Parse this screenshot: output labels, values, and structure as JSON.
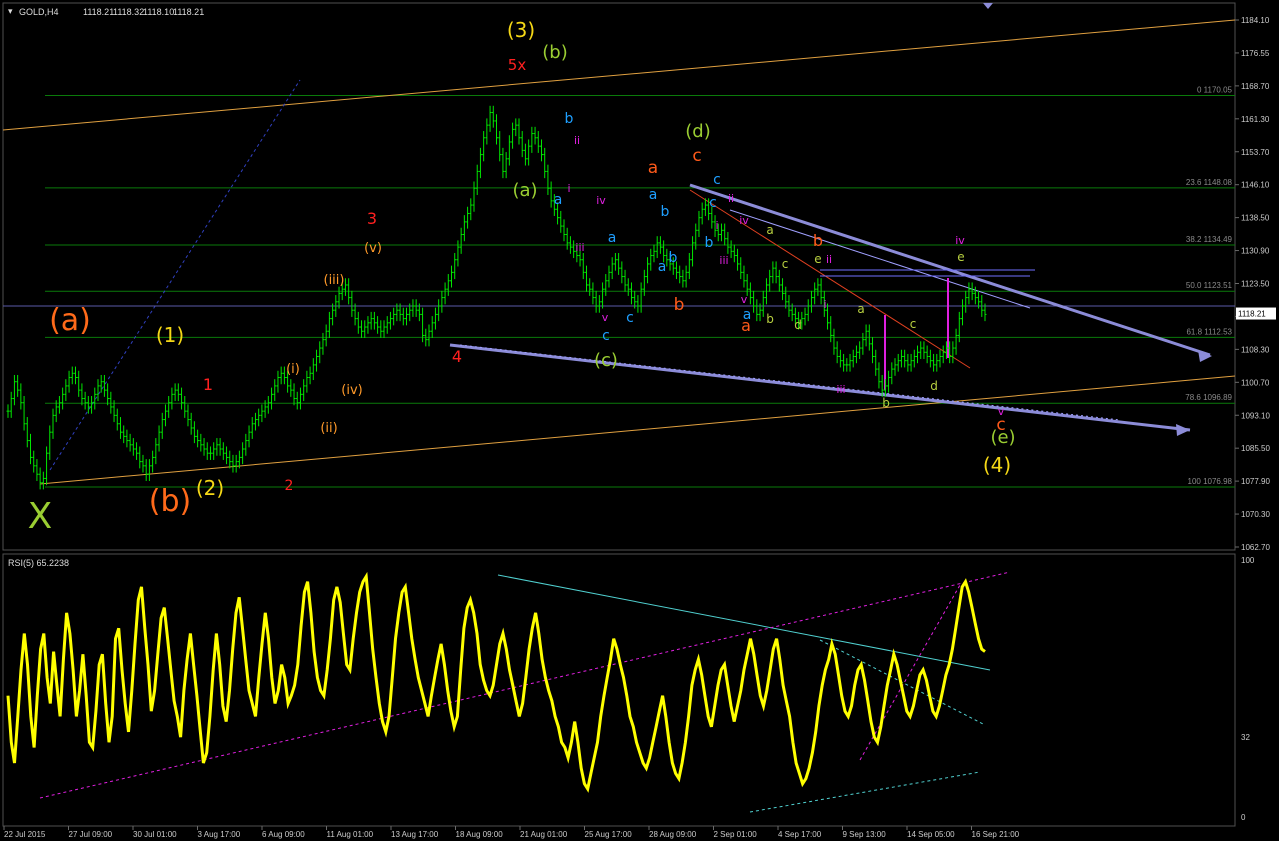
{
  "chart_data": [
    {
      "type": "line",
      "panel": "price",
      "symbol_label": "GOLD,H4",
      "ohlc": [
        "1118.21",
        "1118.32",
        "1118.10",
        "1118.21"
      ],
      "current_price": "1118.21",
      "ylim": [
        1062.7,
        1188.0
      ],
      "price_ticks": [
        "1184.10",
        "1176.55",
        "1168.70",
        "1161.30",
        "1153.70",
        "1146.10",
        "1138.50",
        "1130.90",
        "1123.50",
        "1115.90",
        "1108.30",
        "1100.70",
        "1093.10",
        "1085.50",
        "1077.90",
        "1070.30",
        "1062.70"
      ],
      "close": [
        1095,
        1098,
        1102,
        1100,
        1097,
        1092,
        1088,
        1084,
        1082,
        1080,
        1078,
        1079,
        1085,
        1090,
        1094,
        1096,
        1097,
        1099,
        1101,
        1103,
        1104,
        1103,
        1100,
        1098,
        1097,
        1096,
        1097,
        1099,
        1101,
        1102,
        1100,
        1098,
        1096,
        1094,
        1092,
        1090,
        1089,
        1088,
        1087,
        1086,
        1085,
        1083,
        1082,
        1080,
        1082,
        1084,
        1087,
        1090,
        1093,
        1095,
        1097,
        1099,
        1100,
        1099,
        1097,
        1095,
        1093,
        1091,
        1089,
        1088,
        1087,
        1086,
        1085,
        1085,
        1086,
        1087,
        1086,
        1085,
        1084,
        1083,
        1082,
        1083,
        1084,
        1086,
        1088,
        1090,
        1092,
        1093,
        1094,
        1095,
        1096,
        1097,
        1099,
        1101,
        1103,
        1104,
        1103,
        1101,
        1100,
        1098,
        1097,
        1099,
        1101,
        1103,
        1104,
        1106,
        1108,
        1110,
        1112,
        1114,
        1117,
        1119,
        1121,
        1123,
        1124,
        1125,
        1122,
        1119,
        1117,
        1115,
        1114,
        1115,
        1116,
        1117,
        1116,
        1115,
        1114,
        1115,
        1116,
        1117,
        1118,
        1119,
        1118,
        1117,
        1118,
        1119,
        1120,
        1119,
        1118,
        1113,
        1112,
        1114,
        1116,
        1118,
        1120,
        1122,
        1124,
        1126,
        1128,
        1131,
        1134,
        1137,
        1140,
        1142,
        1144,
        1148,
        1152,
        1156,
        1160,
        1163,
        1166,
        1164,
        1160,
        1156,
        1152,
        1155,
        1159,
        1162,
        1163,
        1160,
        1157,
        1155,
        1158,
        1161,
        1160,
        1158,
        1156,
        1152,
        1148,
        1145,
        1143,
        1141,
        1139,
        1137,
        1135,
        1134,
        1133,
        1132,
        1131,
        1128,
        1125,
        1124,
        1122,
        1120,
        1121,
        1124,
        1126,
        1128,
        1130,
        1131,
        1129,
        1127,
        1125,
        1124,
        1122,
        1121,
        1120,
        1124,
        1127,
        1130,
        1132,
        1133,
        1135,
        1134,
        1132,
        1131,
        1130,
        1129,
        1128,
        1127,
        1126,
        1128,
        1131,
        1135,
        1138,
        1141,
        1143,
        1144,
        1142,
        1140,
        1138,
        1137,
        1138,
        1136,
        1134,
        1133,
        1132,
        1130,
        1128,
        1126,
        1124,
        1122,
        1120,
        1118,
        1119,
        1122,
        1125,
        1127,
        1129,
        1127,
        1125,
        1123,
        1121,
        1119,
        1118,
        1117,
        1116,
        1117,
        1118,
        1120,
        1122,
        1124,
        1125,
        1122,
        1119,
        1116,
        1113,
        1110,
        1108,
        1107,
        1106,
        1106,
        1107,
        1108,
        1109,
        1110,
        1112,
        1114,
        1111,
        1108,
        1105,
        1102,
        1100,
        1101,
        1103,
        1105,
        1106,
        1107,
        1108,
        1107,
        1106,
        1107,
        1108,
        1109,
        1110,
        1109,
        1108,
        1107,
        1106,
        1107,
        1108,
        1109,
        1110,
        1108,
        1110,
        1113,
        1117,
        1120,
        1122,
        1124,
        1123,
        1122,
        1121,
        1119,
        1118
      ],
      "fib_levels": [
        {
          "label": "0 1170.05",
          "value": 1170.05
        },
        {
          "label": "23.6 1148.08",
          "value": 1148.08
        },
        {
          "label": "38.2 1134.49",
          "value": 1134.49
        },
        {
          "label": "50.0 1123.51",
          "value": 1123.51
        },
        {
          "label": "61.8 1112.53",
          "value": 1112.53
        },
        {
          "label": "78.6 1096.89",
          "value": 1096.89
        },
        {
          "label": "100 1076.98",
          "value": 1076.98
        }
      ],
      "wave_labels": [
        {
          "text": "(a)",
          "color": "#ff6a1a"
        },
        {
          "text": "(1)",
          "color": "#f5d816"
        },
        {
          "text": "(b)",
          "color": "#ff6a1a"
        },
        {
          "text": "(2)",
          "color": "#f5d816"
        },
        {
          "text": "X",
          "color": "#9acd32"
        },
        {
          "text": "1",
          "color": "#ff2020"
        },
        {
          "text": "2",
          "color": "#ff2020"
        },
        {
          "text": "3",
          "color": "#ff2020"
        },
        {
          "text": "4",
          "color": "#ff2020"
        },
        {
          "text": "5x",
          "color": "#ff2020"
        },
        {
          "text": "(3)",
          "color": "#f5d816"
        },
        {
          "text": "(4)",
          "color": "#f5d816"
        },
        {
          "text": "(i)",
          "color": "#ff9a2a"
        },
        {
          "text": "(ii)",
          "color": "#ff9a2a"
        },
        {
          "text": "(iii)",
          "color": "#ff9a2a"
        },
        {
          "text": "(iv)",
          "color": "#ff9a2a"
        },
        {
          "text": "(v)",
          "color": "#ff9a2a"
        },
        {
          "text": "(a)",
          "color": "#9acd32"
        },
        {
          "text": "(b)",
          "color": "#9acd32"
        },
        {
          "text": "(c)",
          "color": "#9acd32"
        },
        {
          "text": "(d)",
          "color": "#9acd32"
        },
        {
          "text": "(e)",
          "color": "#9acd32"
        },
        {
          "text": "a",
          "color": "#1e9fff"
        },
        {
          "text": "b",
          "color": "#1e9fff"
        },
        {
          "text": "c",
          "color": "#1e9fff"
        },
        {
          "text": "a",
          "color": "#1e9fff"
        },
        {
          "text": "b",
          "color": "#1e9fff"
        },
        {
          "text": "a",
          "color": "#1e9fff"
        },
        {
          "text": "c",
          "color": "#1e9fff"
        },
        {
          "text": "a",
          "color": "#1e9fff"
        },
        {
          "text": "b",
          "color": "#1e9fff"
        },
        {
          "text": "c",
          "color": "#1e9fff"
        },
        {
          "text": "b",
          "color": "#1e9fff"
        },
        {
          "text": "a",
          "color": "#1e9fff"
        },
        {
          "text": "c",
          "color": "#1e9fff"
        },
        {
          "text": "i",
          "color": "#e020e0"
        },
        {
          "text": "ii",
          "color": "#e020e0"
        },
        {
          "text": "iii",
          "color": "#e020e0"
        },
        {
          "text": "iv",
          "color": "#e020e0"
        },
        {
          "text": "v",
          "color": "#e020e0"
        },
        {
          "text": "i",
          "color": "#e020e0"
        },
        {
          "text": "ii",
          "color": "#e020e0"
        },
        {
          "text": "iii",
          "color": "#e020e0"
        },
        {
          "text": "iv",
          "color": "#e020e0"
        },
        {
          "text": "v",
          "color": "#e020e0"
        },
        {
          "text": "i",
          "color": "#e020e0"
        },
        {
          "text": "ii",
          "color": "#e020e0"
        },
        {
          "text": "iii",
          "color": "#e020e0"
        },
        {
          "text": "iv",
          "color": "#e020e0"
        },
        {
          "text": "v",
          "color": "#e020e0"
        },
        {
          "text": "a",
          "color": "#ff5a1a"
        },
        {
          "text": "b",
          "color": "#ff5a1a"
        },
        {
          "text": "c",
          "color": "#ff5a1a"
        },
        {
          "text": "a",
          "color": "#ff5a1a"
        },
        {
          "text": "b",
          "color": "#ff5a1a"
        },
        {
          "text": "c",
          "color": "#ff5a1a"
        },
        {
          "text": "a",
          "color": "#b8d040"
        },
        {
          "text": "b",
          "color": "#b8d040"
        },
        {
          "text": "c",
          "color": "#b8d040"
        },
        {
          "text": "d",
          "color": "#b8d040"
        },
        {
          "text": "e",
          "color": "#b8d040"
        },
        {
          "text": "a",
          "color": "#b8d040"
        },
        {
          "text": "b",
          "color": "#b8d040"
        },
        {
          "text": "c",
          "color": "#b8d040"
        },
        {
          "text": "d",
          "color": "#b8d040"
        },
        {
          "text": "e",
          "color": "#b8d040"
        }
      ]
    },
    {
      "type": "line",
      "panel": "indicator",
      "label": "RSI(5) 65.2238",
      "ylim": [
        0,
        100
      ],
      "ticks": [
        "100",
        "32",
        "0"
      ],
      "values": [
        48,
        30,
        22,
        40,
        58,
        72,
        60,
        40,
        28,
        48,
        66,
        72,
        55,
        45,
        65,
        52,
        40,
        62,
        80,
        72,
        58,
        40,
        50,
        64,
        48,
        30,
        28,
        42,
        60,
        64,
        45,
        30,
        40,
        70,
        74,
        58,
        45,
        34,
        50,
        68,
        85,
        90,
        74,
        60,
        42,
        50,
        64,
        78,
        82,
        70,
        58,
        46,
        40,
        32,
        50,
        62,
        72,
        60,
        48,
        35,
        22,
        26,
        40,
        58,
        72,
        60,
        44,
        38,
        50,
        66,
        80,
        86,
        74,
        62,
        50,
        45,
        40,
        55,
        68,
        80,
        70,
        55,
        45,
        50,
        60,
        55,
        45,
        48,
        52,
        60,
        75,
        88,
        92,
        80,
        65,
        55,
        50,
        48,
        58,
        70,
        85,
        90,
        84,
        72,
        60,
        58,
        70,
        80,
        88,
        92,
        94,
        80,
        66,
        55,
        45,
        38,
        34,
        40,
        55,
        70,
        80,
        88,
        90,
        80,
        70,
        62,
        55,
        50,
        45,
        40,
        48,
        55,
        62,
        68,
        60,
        50,
        42,
        36,
        40,
        58,
        74,
        82,
        85,
        80,
        72,
        60,
        54,
        50,
        48,
        52,
        60,
        68,
        72,
        66,
        58,
        52,
        46,
        40,
        45,
        55,
        66,
        74,
        80,
        72,
        62,
        55,
        50,
        46,
        40,
        36,
        30,
        28,
        24,
        30,
        38,
        30,
        20,
        14,
        12,
        18,
        24,
        30,
        40,
        48,
        55,
        62,
        70,
        66,
        60,
        55,
        48,
        40,
        36,
        30,
        26,
        22,
        20,
        24,
        30,
        36,
        42,
        48,
        40,
        30,
        22,
        18,
        16,
        22,
        30,
        40,
        52,
        58,
        62,
        56,
        48,
        40,
        36,
        44,
        52,
        58,
        60,
        52,
        44,
        38,
        44,
        50,
        58,
        64,
        70,
        64,
        56,
        48,
        44,
        50,
        58,
        66,
        70,
        62,
        52,
        46,
        40,
        30,
        22,
        18,
        14,
        16,
        20,
        26,
        34,
        44,
        52,
        58,
        62,
        68,
        64,
        56,
        48,
        42,
        40,
        44,
        52,
        58,
        60,
        54,
        46,
        38,
        32,
        30,
        36,
        44,
        52,
        58,
        64,
        60,
        54,
        48,
        42,
        40,
        44,
        50,
        56,
        58,
        54,
        48,
        42,
        40,
        44,
        50,
        56,
        60,
        66,
        74,
        82,
        90,
        92,
        88,
        82,
        76,
        70,
        66,
        65
      ]
    }
  ],
  "time_axis": {
    "labels": [
      "22 Jul 2015",
      "27 Jul 09:00",
      "30 Jul 01:00",
      "3 Aug 17:00",
      "6 Aug 09:00",
      "11 Aug 01:00",
      "13 Aug 17:00",
      "18 Aug 09:00",
      "21 Aug 01:00",
      "25 Aug 17:00",
      "28 Aug 09:00",
      "2 Sep 01:00",
      "4 Sep 17:00",
      "9 Sep 13:00",
      "14 Sep 05:00",
      "16 Sep 21:00"
    ]
  },
  "colors": {
    "background": "#000000",
    "candles": "#00e600",
    "rsi": "#ffff00",
    "fib": "#0a7a0a",
    "trendlines": "#8c8cd8",
    "channel": "#e0a040",
    "grid_axis": "#6a6a6a"
  }
}
